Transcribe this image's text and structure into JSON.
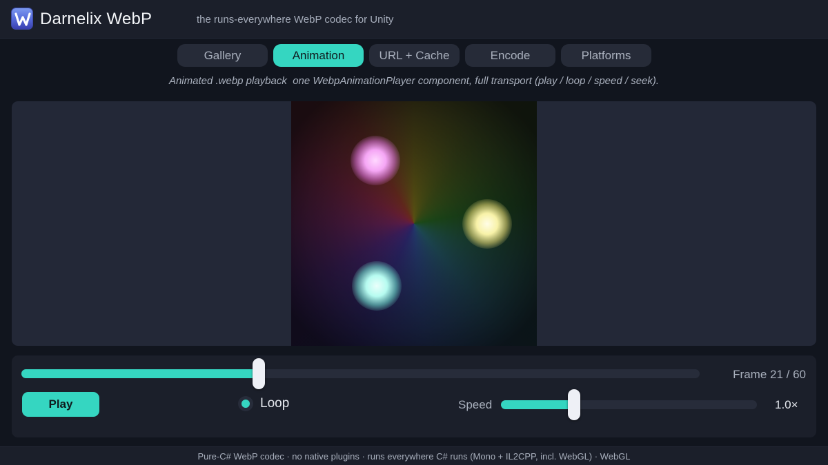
{
  "header": {
    "logo_letter": "W",
    "title": "Darnelix WebP",
    "subtitle": "the runs-everywhere WebP codec for Unity"
  },
  "tabs": [
    {
      "label": "Gallery",
      "active": false
    },
    {
      "label": "Animation",
      "active": true
    },
    {
      "label": "URL + Cache",
      "active": false
    },
    {
      "label": "Encode",
      "active": false
    },
    {
      "label": "Platforms",
      "active": false
    }
  ],
  "description": "Animated .webp playback  one WebpAnimationPlayer component, full transport (play / loop / speed / seek).",
  "transport": {
    "frame_label": "Frame 21 / 60",
    "seek_progress": 0.35,
    "play_label": "Play",
    "loop_label": "Loop",
    "loop_on": true,
    "speed_label": "Speed",
    "speed_value": "1.0×",
    "speed_progress": 0.285
  },
  "footer": "Pure-C# WebP codec · no native plugins · runs everywhere C# runs (Mono + IL2CPP, incl. WebGL) · WebGL",
  "colors": {
    "accent": "#35d6c1",
    "background": "#11151e",
    "panel": "#232837"
  }
}
